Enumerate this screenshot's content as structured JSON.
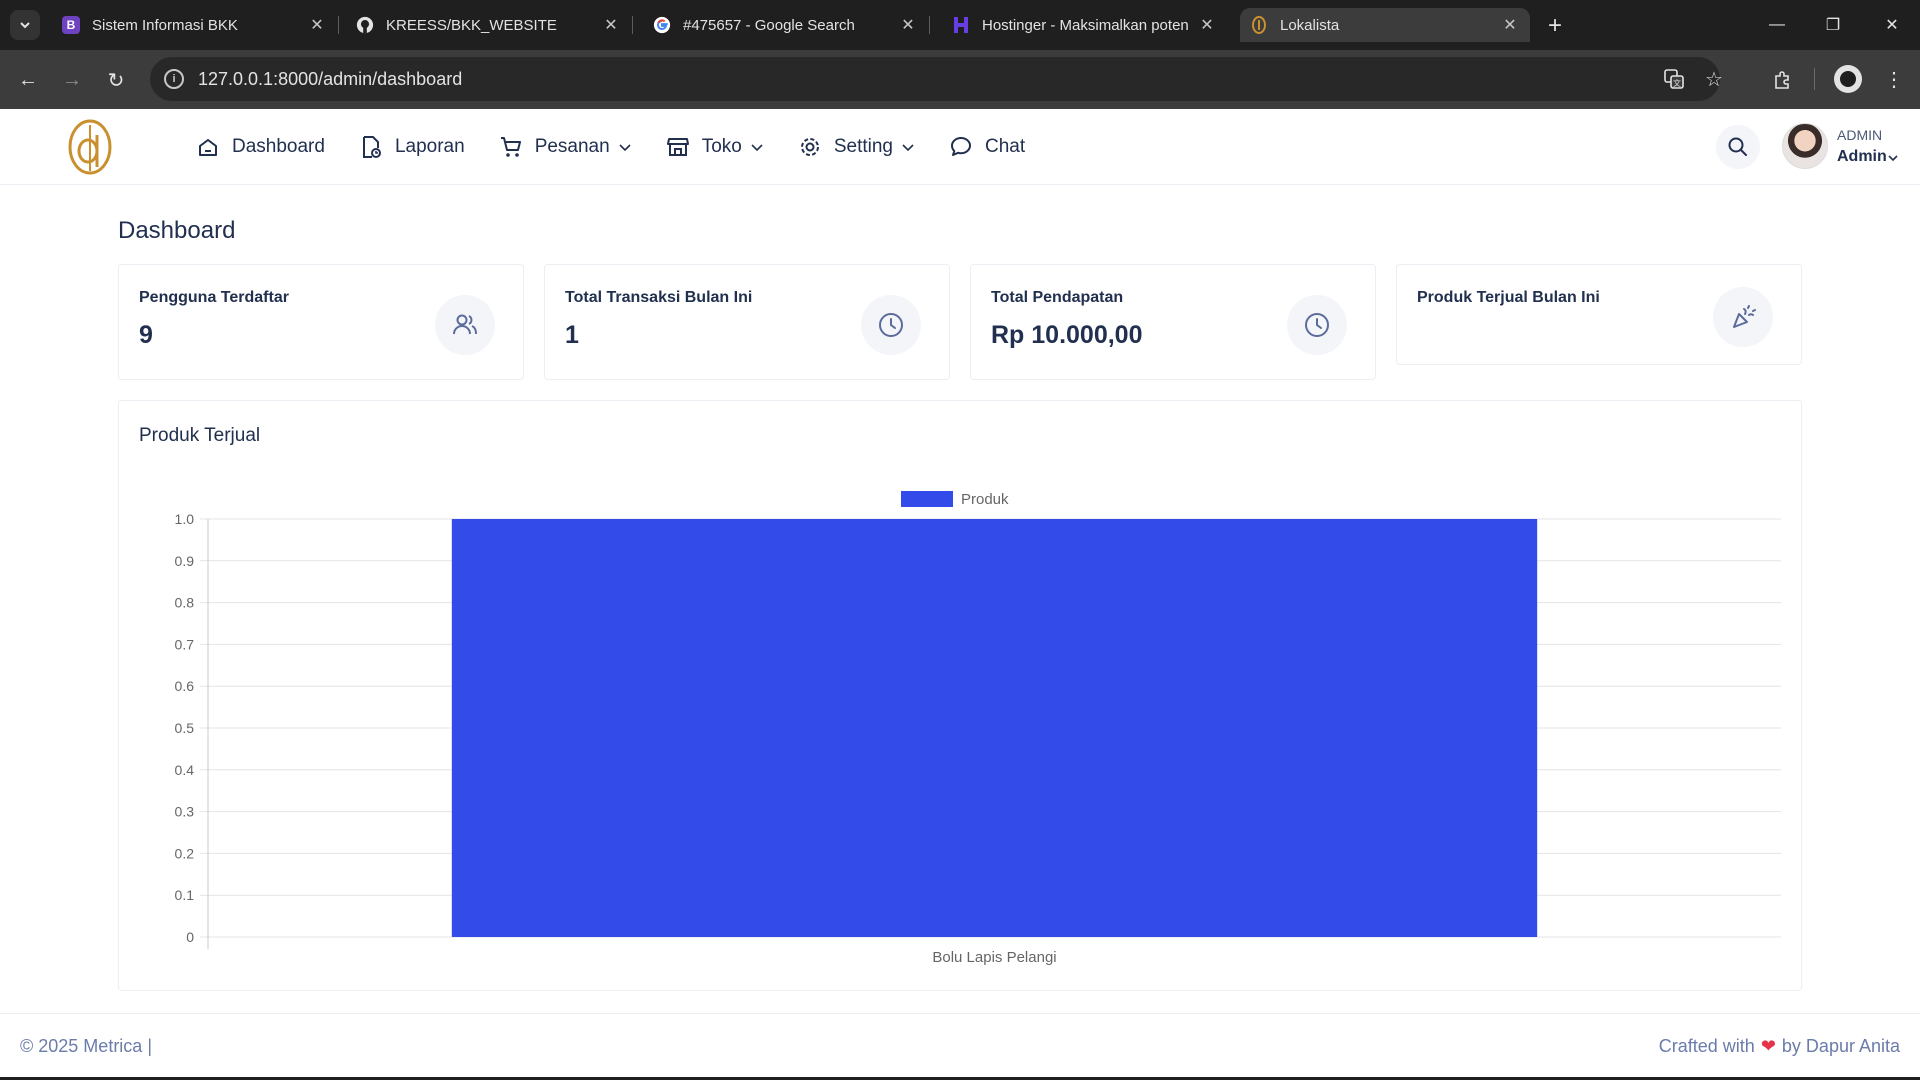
{
  "browser": {
    "tabs": [
      {
        "title": "Sistem Informasi BKK",
        "favicon": "bootstrap-icon",
        "favicon_text": "B",
        "favicon_color": "#6f42c1"
      },
      {
        "title": "KREESS/BKK_WEBSITE",
        "favicon": "github-icon"
      },
      {
        "title": "#475657 - Google Search",
        "favicon": "google-icon"
      },
      {
        "title": "Hostinger - Maksimalkan poten",
        "favicon": "hostinger-icon",
        "favicon_color": "#673de6"
      },
      {
        "title": "Lokalista",
        "favicon": "lokalista-icon",
        "favicon_color": "#c8902e",
        "active": true
      }
    ],
    "url": "127.0.0.1:8000/admin/dashboard"
  },
  "app": {
    "brand_color": "#c8902e",
    "nav": [
      {
        "label": "Dashboard",
        "icon": "home-icon"
      },
      {
        "label": "Laporan",
        "icon": "report-file-icon"
      },
      {
        "label": "Pesanan",
        "icon": "cart-icon",
        "dropdown": true
      },
      {
        "label": "Toko",
        "icon": "store-icon",
        "dropdown": true
      },
      {
        "label": "Setting",
        "icon": "gear-icon",
        "dropdown": true
      },
      {
        "label": "Chat",
        "icon": "chat-icon"
      }
    ],
    "user": {
      "role": "ADMIN",
      "name": "Admin"
    }
  },
  "page": {
    "title": "Dashboard",
    "stats": [
      {
        "label": "Pengguna Terdaftar",
        "value": "9",
        "icon": "users-icon"
      },
      {
        "label": "Total Transaksi Bulan Ini",
        "value": "1",
        "icon": "clock-icon"
      },
      {
        "label": "Total Pendapatan",
        "value": "Rp 10.000,00",
        "icon": "clock-icon"
      },
      {
        "label": "Produk Terjual Bulan Ini",
        "value": "",
        "icon": "party-popper-icon"
      }
    ],
    "chart_title": "Produk Terjual"
  },
  "chart_data": {
    "type": "bar",
    "categories": [
      "Bolu Lapis Pelangi"
    ],
    "series": [
      {
        "name": "Produk",
        "values": [
          1
        ],
        "color": "#334be8"
      }
    ],
    "ylim": [
      0,
      1.0
    ],
    "yticks": [
      "0",
      "0.1",
      "0.2",
      "0.3",
      "0.4",
      "0.5",
      "0.6",
      "0.7",
      "0.8",
      "0.9",
      "1.0"
    ],
    "grid": true,
    "legend": "top-center"
  },
  "footer": {
    "left": "© 2025 Metrica |",
    "right_prefix": "Crafted with",
    "right_suffix": "by Dapur Anita",
    "heart_color": "#e7334a"
  }
}
